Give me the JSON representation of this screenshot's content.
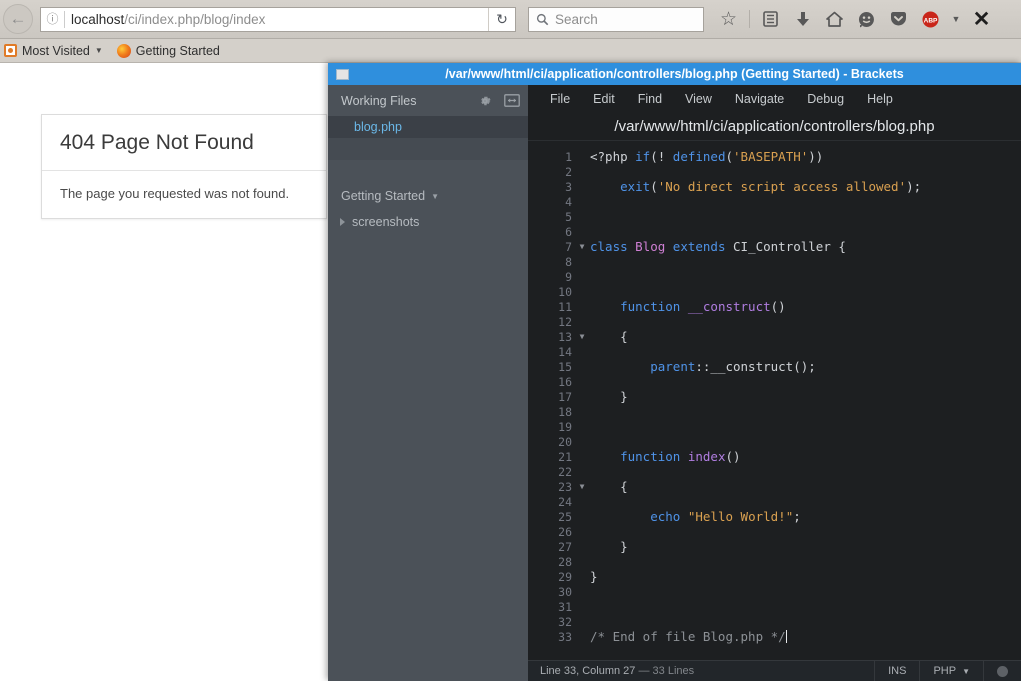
{
  "browser": {
    "back_icon": "back-arrow-icon",
    "url": {
      "host": "localhost",
      "path": "/ci/index.php/blog/index",
      "info_icon": "info-icon",
      "reload_icon": "reload-icon"
    },
    "search": {
      "placeholder": "Search",
      "icon": "search-icon"
    },
    "toolbar_icons": [
      {
        "name": "bookmark-star-icon",
        "glyph": "☆"
      },
      {
        "name": "library-icon",
        "glyph": "▤"
      },
      {
        "name": "downloads-icon",
        "glyph": "⬇"
      },
      {
        "name": "home-icon",
        "glyph": "⌂"
      },
      {
        "name": "sync-smiley-icon",
        "glyph": "☺"
      },
      {
        "name": "pocket-icon",
        "glyph": "▼"
      },
      {
        "name": "adblock-plus-icon",
        "glyph": "ABP"
      },
      {
        "name": "overflow-caret-icon",
        "glyph": "▾"
      },
      {
        "name": "close-window-icon",
        "glyph": "✕"
      }
    ],
    "bookmarks": [
      {
        "label": "Most Visited",
        "icon": "most-visited-icon",
        "has_caret": true
      },
      {
        "label": "Getting Started",
        "icon": "firefox-icon",
        "has_caret": false
      }
    ],
    "page": {
      "error_title": "404 Page Not Found",
      "error_body": "The page you requested was not found."
    }
  },
  "brackets": {
    "window_title": "/var/www/html/ci/application/controllers/blog.php (Getting Started) - Brackets",
    "sidebar": {
      "working_files_label": "Working Files",
      "gear_icon": "gear-icon",
      "split_icon": "split-view-icon",
      "working_files": [
        "blog.php"
      ],
      "project_name": "Getting Started",
      "tree": [
        {
          "label": "screenshots",
          "expanded": false
        }
      ]
    },
    "menu": [
      "File",
      "Edit",
      "Find",
      "View",
      "Navigate",
      "Debug",
      "Help"
    ],
    "file_path": "/var/www/html/ci/application/controllers/blog.php",
    "status": {
      "cursor": "Line 33, Column 27",
      "separator": "—",
      "lines": "33 Lines",
      "insert_mode": "INS",
      "language": "PHP",
      "lang_caret": "▾",
      "indicator": "live-preview-dot"
    },
    "code": {
      "lines": [
        {
          "n": 1,
          "fold": false,
          "tokens": [
            {
              "t": "<?php ",
              "c": "def"
            },
            {
              "t": "if",
              "c": "key"
            },
            {
              "t": "(! ",
              "c": "def"
            },
            {
              "t": "defined",
              "c": "key"
            },
            {
              "t": "(",
              "c": "def"
            },
            {
              "t": "'BASEPATH'",
              "c": "str"
            },
            {
              "t": "))",
              "c": "def"
            }
          ]
        },
        {
          "n": 2,
          "fold": false,
          "tokens": []
        },
        {
          "n": 3,
          "fold": false,
          "tokens": [
            {
              "t": "    ",
              "c": "def"
            },
            {
              "t": "exit",
              "c": "key"
            },
            {
              "t": "(",
              "c": "def"
            },
            {
              "t": "'No direct script access allowed'",
              "c": "str"
            },
            {
              "t": ");",
              "c": "def"
            }
          ]
        },
        {
          "n": 4,
          "fold": false,
          "tokens": []
        },
        {
          "n": 5,
          "fold": false,
          "tokens": []
        },
        {
          "n": 6,
          "fold": false,
          "tokens": []
        },
        {
          "n": 7,
          "fold": true,
          "tokens": [
            {
              "t": "class ",
              "c": "key"
            },
            {
              "t": "Blog ",
              "c": "cls"
            },
            {
              "t": "extends ",
              "c": "key"
            },
            {
              "t": "CI_Controller {",
              "c": "def"
            }
          ]
        },
        {
          "n": 8,
          "fold": false,
          "tokens": []
        },
        {
          "n": 9,
          "fold": false,
          "tokens": []
        },
        {
          "n": 10,
          "fold": false,
          "tokens": []
        },
        {
          "n": 11,
          "fold": false,
          "tokens": [
            {
              "t": "    ",
              "c": "def"
            },
            {
              "t": "function ",
              "c": "key"
            },
            {
              "t": "__construct",
              "c": "fn"
            },
            {
              "t": "()",
              "c": "def"
            }
          ]
        },
        {
          "n": 12,
          "fold": false,
          "tokens": []
        },
        {
          "n": 13,
          "fold": true,
          "tokens": [
            {
              "t": "    {",
              "c": "def"
            }
          ]
        },
        {
          "n": 14,
          "fold": false,
          "tokens": []
        },
        {
          "n": 15,
          "fold": false,
          "tokens": [
            {
              "t": "        ",
              "c": "def"
            },
            {
              "t": "parent",
              "c": "key"
            },
            {
              "t": "::__construct();",
              "c": "def"
            }
          ]
        },
        {
          "n": 16,
          "fold": false,
          "tokens": []
        },
        {
          "n": 17,
          "fold": false,
          "tokens": [
            {
              "t": "    }",
              "c": "def"
            }
          ]
        },
        {
          "n": 18,
          "fold": false,
          "tokens": []
        },
        {
          "n": 19,
          "fold": false,
          "tokens": []
        },
        {
          "n": 20,
          "fold": false,
          "tokens": []
        },
        {
          "n": 21,
          "fold": false,
          "tokens": [
            {
              "t": "    ",
              "c": "def"
            },
            {
              "t": "function ",
              "c": "key"
            },
            {
              "t": "index",
              "c": "fn"
            },
            {
              "t": "()",
              "c": "def"
            }
          ]
        },
        {
          "n": 22,
          "fold": false,
          "tokens": []
        },
        {
          "n": 23,
          "fold": true,
          "tokens": [
            {
              "t": "    {",
              "c": "def"
            }
          ]
        },
        {
          "n": 24,
          "fold": false,
          "tokens": []
        },
        {
          "n": 25,
          "fold": false,
          "tokens": [
            {
              "t": "        ",
              "c": "def"
            },
            {
              "t": "echo ",
              "c": "key"
            },
            {
              "t": "\"Hello World!\"",
              "c": "str"
            },
            {
              "t": ";",
              "c": "def"
            }
          ]
        },
        {
          "n": 26,
          "fold": false,
          "tokens": []
        },
        {
          "n": 27,
          "fold": false,
          "tokens": [
            {
              "t": "    }",
              "c": "def"
            }
          ]
        },
        {
          "n": 28,
          "fold": false,
          "tokens": []
        },
        {
          "n": 29,
          "fold": false,
          "tokens": [
            {
              "t": "}",
              "c": "def"
            }
          ]
        },
        {
          "n": 30,
          "fold": false,
          "tokens": []
        },
        {
          "n": 31,
          "fold": false,
          "tokens": []
        },
        {
          "n": 32,
          "fold": false,
          "tokens": []
        },
        {
          "n": 33,
          "fold": false,
          "cursor": true,
          "tokens": [
            {
              "t": "/* End of file Blog.php */",
              "c": "cmt"
            }
          ]
        }
      ]
    }
  }
}
